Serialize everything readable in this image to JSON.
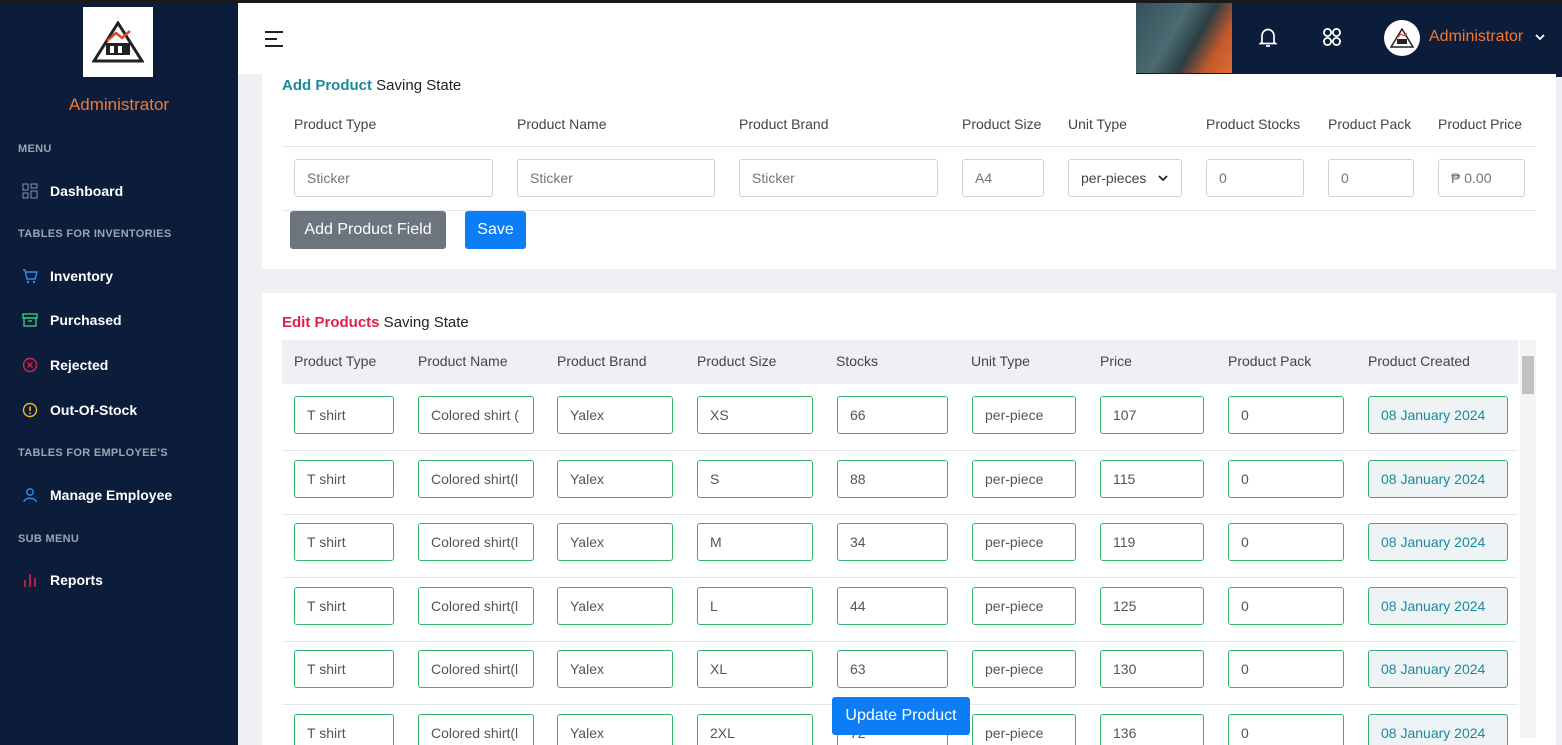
{
  "sidebar": {
    "admin_name": "Administrator",
    "sections": [
      {
        "label": "MENU"
      },
      {
        "label": "TABLES FOR INVENTORIES"
      },
      {
        "label": "TABLES FOR EMPLOYEE'S"
      },
      {
        "label": "SUB MENU"
      }
    ],
    "items": [
      {
        "label": "Dashboard",
        "icon": "dashboard-grid-icon"
      },
      {
        "label": "Inventory",
        "icon": "cart-icon"
      },
      {
        "label": "Purchased",
        "icon": "archive-box-icon"
      },
      {
        "label": "Rejected",
        "icon": "x-circle-icon"
      },
      {
        "label": "Out-Of-Stock",
        "icon": "alert-circle-icon"
      },
      {
        "label": "Manage Employee",
        "icon": "user-icon"
      },
      {
        "label": "Reports",
        "icon": "bar-chart-icon"
      }
    ]
  },
  "topbar": {
    "user_name": "Administrator",
    "icons": [
      "hamburger-menu-icon",
      "bell-icon",
      "apps-grid-icon",
      "chevron-down-icon"
    ]
  },
  "add_product": {
    "title_highlight": "Add Product",
    "title_rest": " Saving State",
    "headers": [
      "Product Type",
      "Product Name",
      "Product Brand",
      "Product Size",
      "Unit Type",
      "Product Stocks",
      "Product Pack",
      "Product Price"
    ],
    "placeholders": {
      "type": "Sticker",
      "name": "Sticker",
      "brand": "Sticker",
      "size": "A4",
      "unit": "per-pieces",
      "stocks": "0",
      "pack": "0",
      "price": "₱ 0.00"
    },
    "add_field_button": "Add Product Field",
    "save_button": "Save"
  },
  "edit_products": {
    "title_highlight": "Edit Products",
    "title_rest": " Saving State",
    "headers": [
      "Product Type",
      "Product Name",
      "Product Brand",
      "Product Size",
      "Stocks",
      "Unit Type",
      "Price",
      "Product Pack",
      "Product Created"
    ],
    "rows": [
      {
        "type": "T shirt",
        "name": "Colored shirt (",
        "brand": "Yalex",
        "size": "XS",
        "stocks": "66",
        "unit": "per-piece",
        "price": "107",
        "pack": "0",
        "created": "08 January 2024"
      },
      {
        "type": "T shirt",
        "name": "Colored shirt(l",
        "brand": "Yalex",
        "size": "S",
        "stocks": "88",
        "unit": "per-piece",
        "price": "115",
        "pack": "0",
        "created": "08 January 2024"
      },
      {
        "type": "T shirt",
        "name": "Colored shirt(l",
        "brand": "Yalex",
        "size": "M",
        "stocks": "34",
        "unit": "per-piece",
        "price": "119",
        "pack": "0",
        "created": "08 January 2024"
      },
      {
        "type": "T shirt",
        "name": "Colored shirt(l",
        "brand": "Yalex",
        "size": "L",
        "stocks": "44",
        "unit": "per-piece",
        "price": "125",
        "pack": "0",
        "created": "08 January 2024"
      },
      {
        "type": "T shirt",
        "name": "Colored shirt(l",
        "brand": "Yalex",
        "size": "XL",
        "stocks": "63",
        "unit": "per-piece",
        "price": "130",
        "pack": "0",
        "created": "08 January 2024"
      },
      {
        "type": "T shirt",
        "name": "Colored shirt(l",
        "brand": "Yalex",
        "size": "2XL",
        "stocks": "72",
        "unit": "per-piece",
        "price": "136",
        "pack": "0",
        "created": "08 January 2024"
      }
    ],
    "update_button": "Update Product"
  },
  "colors": {
    "sidebar_bg": "#0b1d3a",
    "accent_orange": "#f7772a",
    "teal": "#1b8a9b",
    "red": "#e0204a",
    "input_green": "#37b26c",
    "primary_blue": "#0d7df5"
  }
}
